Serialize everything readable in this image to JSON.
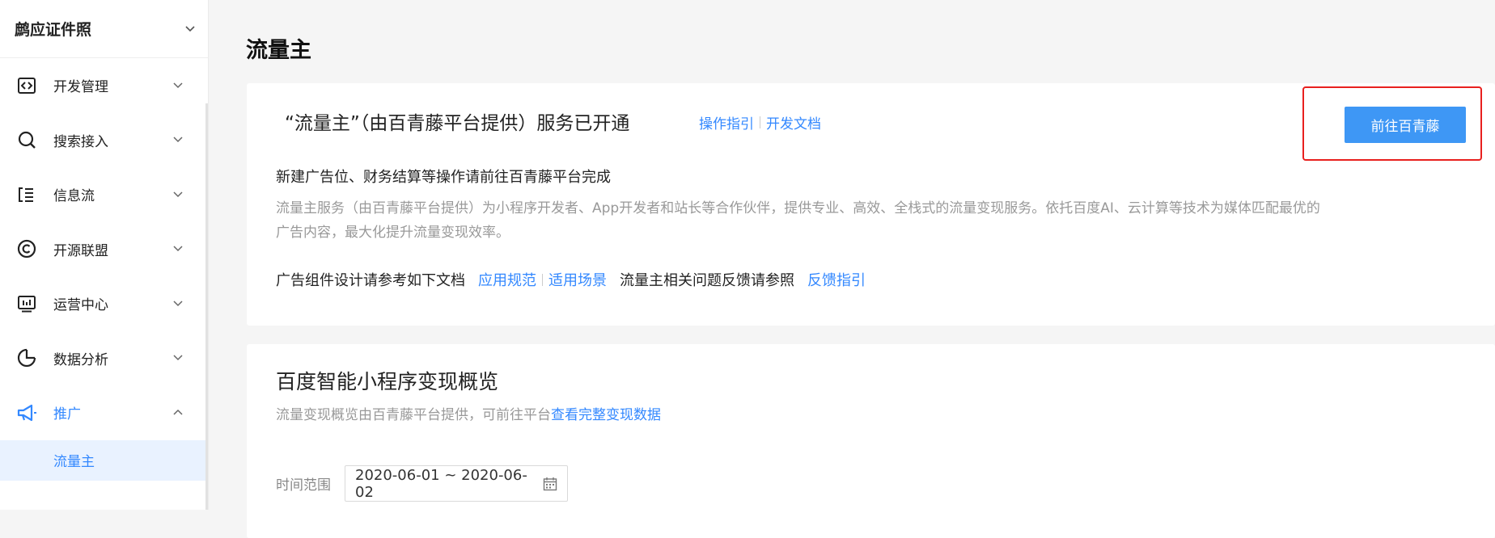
{
  "app_switcher": {
    "name": "鹧应证件照"
  },
  "sidebar": {
    "items": [
      {
        "label": "开发管理",
        "icon": "code-brackets-icon"
      },
      {
        "label": "搜索接入",
        "icon": "search-icon"
      },
      {
        "label": "信息流",
        "icon": "feed-list-icon"
      },
      {
        "label": "开源联盟",
        "icon": "copyright-icon"
      },
      {
        "label": "运营中心",
        "icon": "monitor-chart-icon"
      },
      {
        "label": "数据分析",
        "icon": "pie-chart-icon"
      },
      {
        "label": "推广",
        "icon": "megaphone-icon",
        "active": true
      }
    ],
    "sub_items": [
      {
        "label": "流量主",
        "selected": true
      }
    ]
  },
  "page": {
    "title": "流量主"
  },
  "service_card": {
    "title": "“流量主”（由百青藤平台提供）服务已开通",
    "link_guide": "操作指引",
    "link_docs": "开发文档",
    "button": "前往百青藤",
    "subheading": "新建广告位、财务结算等操作请前往百青藤平台完成",
    "description": "流量主服务（由百青藤平台提供）为小程序开发者、App开发者和站长等合作伙伴，提供专业、高效、全栈式的流量变现服务。依托百度AI、云计算等技术为媒体匹配最优的广告内容，最大化提升流量变现效率。",
    "doc_prefix": "广告组件设计请参考如下文档",
    "link_spec": "应用规范",
    "link_scene": "适用场景",
    "feedback_prefix": "流量主相关问题反馈请参照",
    "link_feedback": "反馈指引"
  },
  "overview_card": {
    "title": "百度智能小程序变现概览",
    "desc_prefix": "流量变现概览由百青藤平台提供，可前往平台",
    "desc_link": "查看完整变现数据",
    "range_label": "时间范围",
    "date_range": "2020-06-01 ~ 2020-06-02"
  },
  "colors": {
    "accent": "#3388ff",
    "button": "#3e97f5",
    "highlight_box": "#e8201e",
    "selected_bg": "#e9f2ff"
  }
}
